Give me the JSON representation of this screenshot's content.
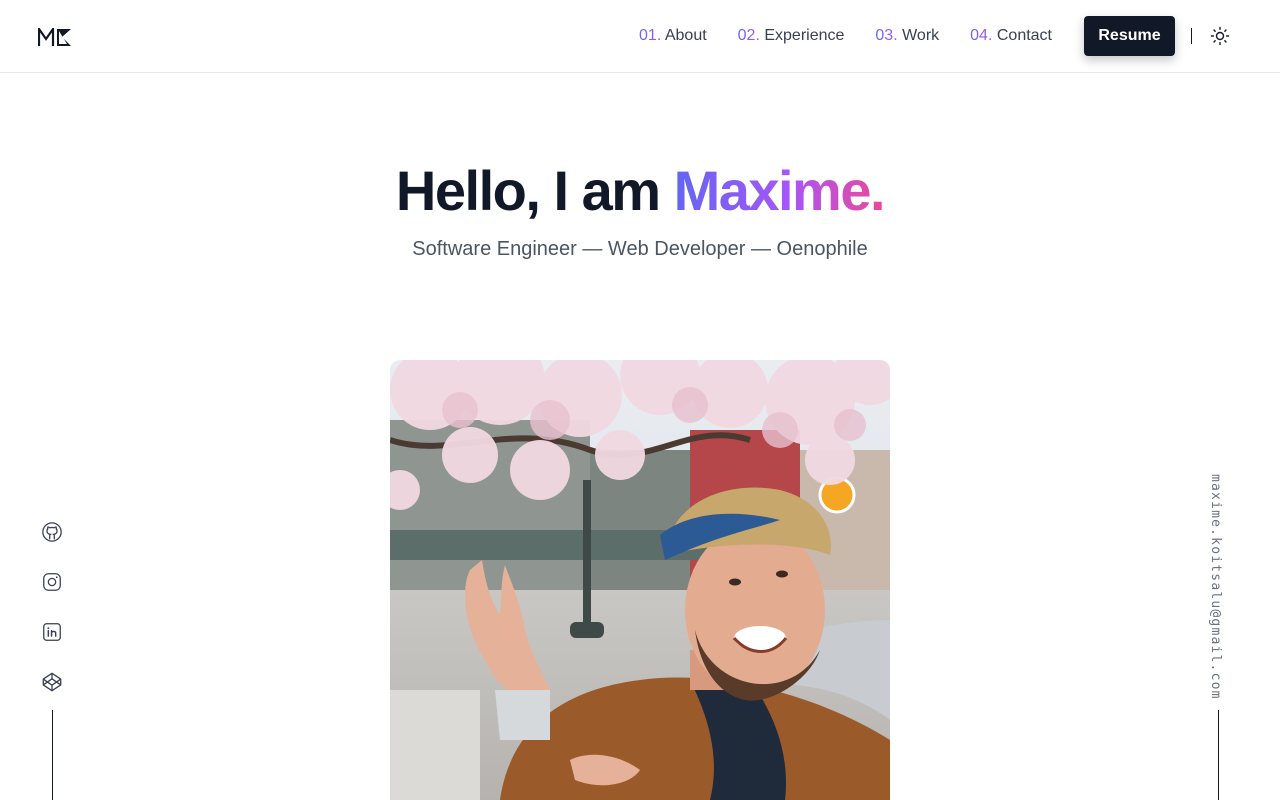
{
  "logo": {
    "text": "MK"
  },
  "nav": {
    "items": [
      {
        "num": "01.",
        "label": "About"
      },
      {
        "num": "02.",
        "label": "Experience"
      },
      {
        "num": "03.",
        "label": "Work"
      },
      {
        "num": "04.",
        "label": "Contact"
      }
    ],
    "resume_label": "Resume",
    "theme_icon": "sun-icon"
  },
  "hero": {
    "title_prefix": "Hello, I am ",
    "name": "Maxime.",
    "subtitle": "Software Engineer — Web Developer — Oenophile"
  },
  "photo": {
    "description_icon": "profile-photo"
  },
  "socials": [
    {
      "icon": "github-icon"
    },
    {
      "icon": "instagram-icon"
    },
    {
      "icon": "linkedin-icon"
    },
    {
      "icon": "codepen-icon"
    }
  ],
  "email": "maxime.koitsalu@gmail.com",
  "colors": {
    "primary": "#111827",
    "accent_start": "#6366f1",
    "accent_mid": "#a855f7",
    "accent_end": "#ec4899",
    "text_muted": "#4b5563"
  }
}
